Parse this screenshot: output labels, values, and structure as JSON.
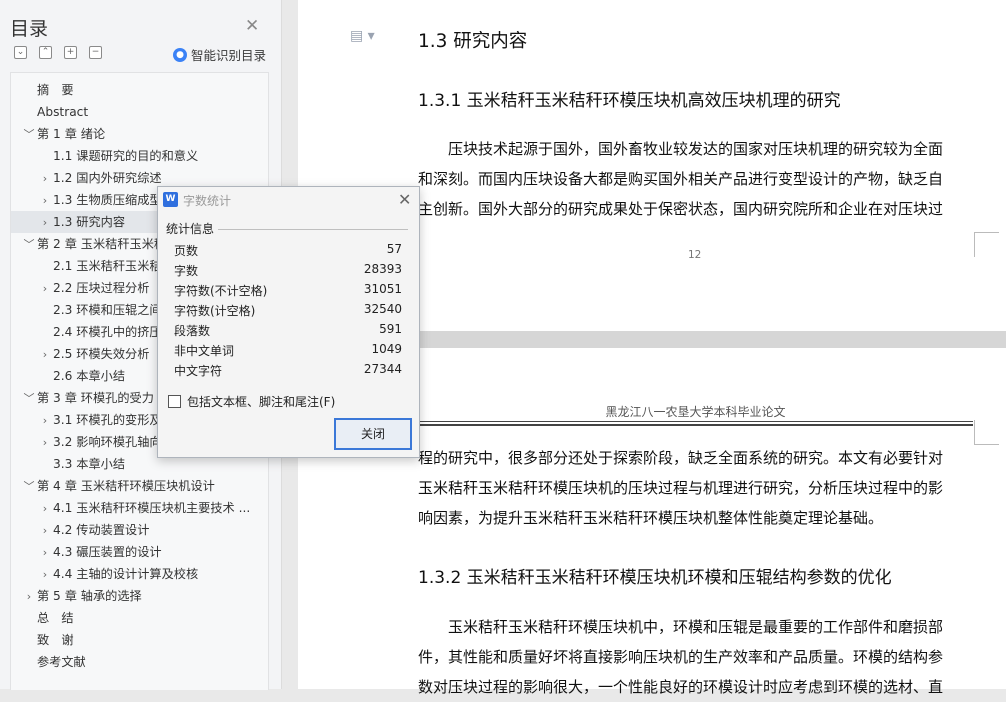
{
  "nav": {
    "title": "目录",
    "smart_label": "智能识别目录",
    "items": [
      {
        "label": "摘　要",
        "level": 0,
        "chev": ""
      },
      {
        "label": "Abstract",
        "level": 0,
        "chev": ""
      },
      {
        "label": "第 1 章  绪论",
        "level": 0,
        "chev": "﹀"
      },
      {
        "label": "1.1  课题研究的目的和意义",
        "level": 1,
        "chev": ""
      },
      {
        "label": "1.2  国内外研究综述",
        "level": 1,
        "chev": "›"
      },
      {
        "label": "1.3 生物质压缩成型",
        "level": 1,
        "chev": "›"
      },
      {
        "label": "1.3 研究内容",
        "level": 1,
        "chev": "›",
        "selected": true
      },
      {
        "label": "第 2 章  玉米秸秆玉米秸",
        "level": 0,
        "chev": "﹀"
      },
      {
        "label": "2.1 玉米秸秆玉米秸",
        "level": 1,
        "chev": ""
      },
      {
        "label": "2.2 压块过程分析",
        "level": 1,
        "chev": "›"
      },
      {
        "label": "2.3 环模和压辊之间",
        "level": 1,
        "chev": ""
      },
      {
        "label": "2.4 环模孔中的挤压",
        "level": 1,
        "chev": ""
      },
      {
        "label": "2.5 环模失效分析",
        "level": 1,
        "chev": "›"
      },
      {
        "label": "2.6 本章小结",
        "level": 1,
        "chev": ""
      },
      {
        "label": "第 3 章  环模孔的受力",
        "level": 0,
        "chev": "﹀"
      },
      {
        "label": "3.1 环模孔的变形及",
        "level": 1,
        "chev": "›"
      },
      {
        "label": "3.2 影响环模孔轴向",
        "level": 1,
        "chev": "›"
      },
      {
        "label": "3.3 本章小结",
        "level": 1,
        "chev": ""
      },
      {
        "label": "第 4 章  玉米秸秆环模压块机设计",
        "level": 0,
        "chev": "﹀"
      },
      {
        "label": "4.1 玉米秸秆环模压块机主要技术 ...",
        "level": 1,
        "chev": "›"
      },
      {
        "label": "4.2 传动装置设计",
        "level": 1,
        "chev": "›"
      },
      {
        "label": "4.3 碾压装置的设计",
        "level": 1,
        "chev": "›"
      },
      {
        "label": "4.4  主轴的设计计算及校核",
        "level": 1,
        "chev": "›"
      },
      {
        "label": "第 5 章  轴承的选择",
        "level": 0,
        "chev": "›"
      },
      {
        "label": "总　结",
        "level": 0,
        "chev": ""
      },
      {
        "label": "致　谢",
        "level": 0,
        "chev": ""
      },
      {
        "label": "参考文献",
        "level": 0,
        "chev": ""
      }
    ]
  },
  "doc": {
    "h2": "1.3 研究内容",
    "h3_1": "1.3.1 玉米秸秆玉米秸秆环模压块机高效压块机理的研究",
    "p1": [
      "　　压块技术起源于国外，国外畜牧业较发达的国家对压块机理的研究较为全面",
      "和深刻。而国内压块设备大都是购买国外相关产品进行变型设计的产物，缺乏自",
      "主创新。国外大部分的研究成果处于保密状态，国内研究院所和企业在对压块过"
    ],
    "page_number": "12",
    "header_text": "黑龙江八一农垦大学本科毕业论文",
    "p2": [
      "程的研究中，很多部分还处于探索阶段，缺乏全面系统的研究。本文有必要针对",
      "玉米秸秆玉米秸秆环模压块机的压块过程与机理进行研究，分析压块过程中的影",
      "响因素，为提升玉米秸秆玉米秸秆环模压块机整体性能奠定理论基础。"
    ],
    "h3_2": "1.3.2 玉米秸秆玉米秸秆环模压块机环模和压辊结构参数的优化",
    "p3": [
      "　　玉米秸秆玉米秸秆环模压块机中，环模和压辊是最重要的工作部件和磨损部",
      "件，其性能和质量好坏将直接影响压块机的生产效率和产品质量。环模的结构参",
      "数对压块过程的影响很大，一个性能良好的环模设计时应考虑到环模的选材、直"
    ]
  },
  "dialog": {
    "title": "字数统计",
    "section": "统计信息",
    "rows": [
      {
        "label": "页数",
        "value": "57"
      },
      {
        "label": "字数",
        "value": "28393"
      },
      {
        "label": "字符数(不计空格)",
        "value": "31051"
      },
      {
        "label": "字符数(计空格)",
        "value": "32540"
      },
      {
        "label": "段落数",
        "value": "591"
      },
      {
        "label": "非中文单词",
        "value": "1049"
      },
      {
        "label": "中文字符",
        "value": "27344"
      }
    ],
    "checkbox_label": "包括文本框、脚注和尾注(F)",
    "close_label": "关闭"
  }
}
